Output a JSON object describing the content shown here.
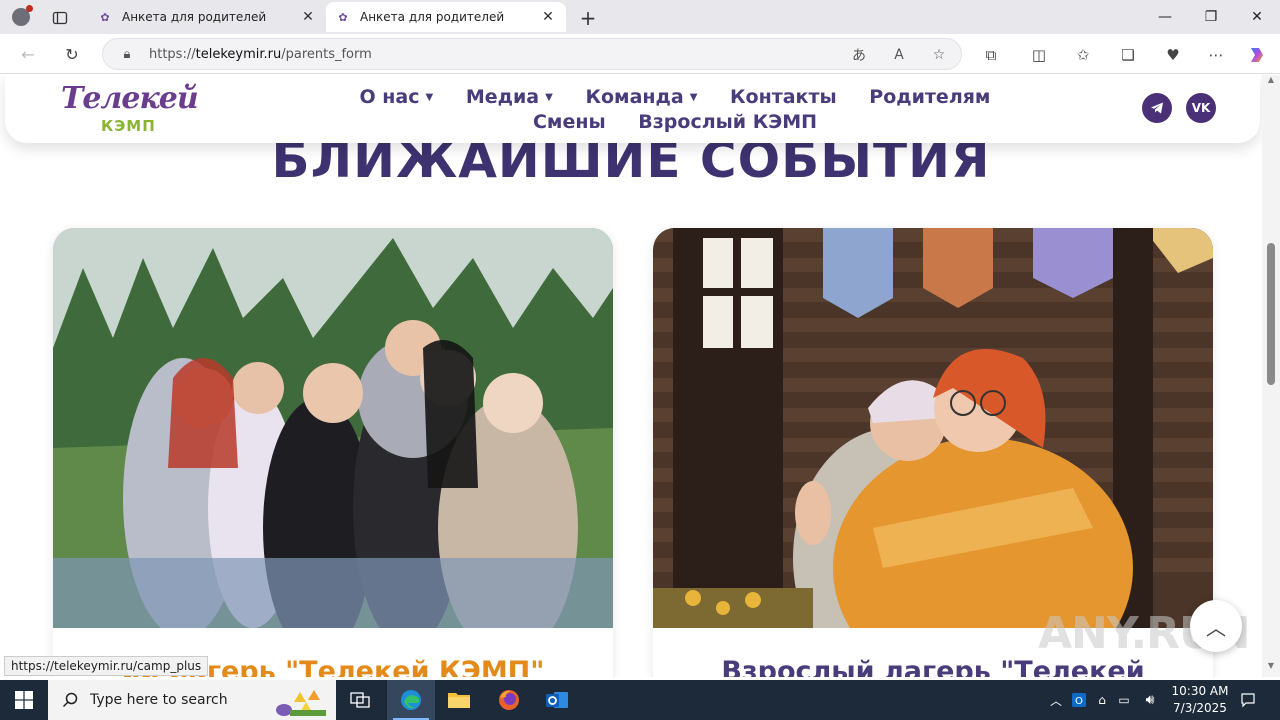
{
  "browser": {
    "tabs": [
      {
        "title": "Анкета для родителей"
      },
      {
        "title": "Анкета для родителей"
      }
    ],
    "url_prefix": "https://",
    "url_domain": "telekeymir.ru",
    "url_path": "/parents_form",
    "status_link": "https://telekeymir.ru/camp_plus"
  },
  "site": {
    "logo_main": "Телекей",
    "logo_sub": "КЭМП",
    "menu": [
      {
        "label": "О нас",
        "has_dropdown": true
      },
      {
        "label": "Медиа",
        "has_dropdown": true
      },
      {
        "label": "Команда",
        "has_dropdown": true
      },
      {
        "label": "Контакты",
        "has_dropdown": false
      },
      {
        "label": "Родителям",
        "has_dropdown": false
      },
      {
        "label": "Смены",
        "has_dropdown": false
      },
      {
        "label": "Взрослый КЭМП",
        "has_dropdown": false
      }
    ],
    "social": {
      "telegram": "telegram-icon",
      "vk_label": "VK"
    },
    "section_title": "БЛИЖАЙШИЕ СОБЫТИЯ",
    "cards": [
      {
        "title": "ий лагерь \"Телекей КЭМП\""
      },
      {
        "title": "Взрослый лагерь \"Телекей"
      }
    ],
    "watermark": "ANY.RUN"
  },
  "taskbar": {
    "search_placeholder": "Type here to search",
    "time": "10:30 AM",
    "date": "7/3/2025"
  },
  "colors": {
    "brand_purple": "#4a3b7a",
    "card1_title": "#e48a1a",
    "logo_green": "#8bb433"
  }
}
